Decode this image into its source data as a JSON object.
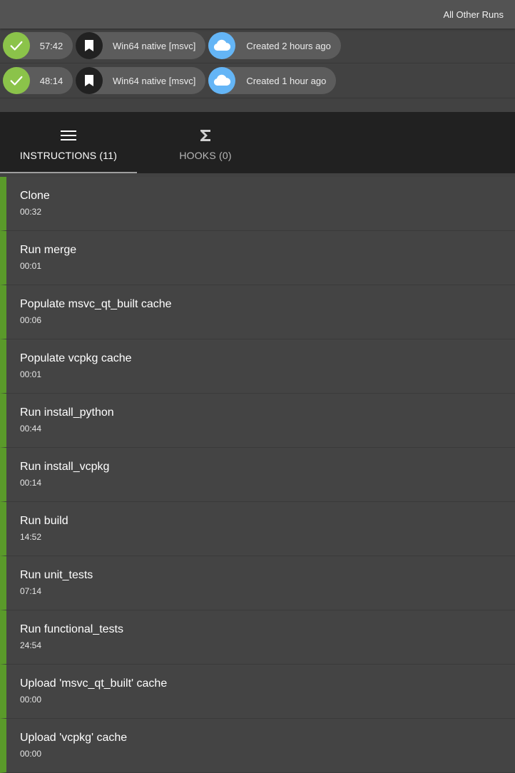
{
  "topbar": {
    "all_other_runs": "All Other Runs"
  },
  "runs": [
    {
      "duration": "57:42",
      "task": "Win64 native [msvc]",
      "created": "Created 2 hours ago"
    },
    {
      "duration": "48:14",
      "task": "Win64 native [msvc]",
      "created": "Created 1 hour ago"
    }
  ],
  "tabs": [
    {
      "label": "INSTRUCTIONS (11)",
      "icon": "menu-icon",
      "active": true
    },
    {
      "label": "HOOKS (0)",
      "icon": "sigma-icon",
      "active": false
    }
  ],
  "steps": [
    {
      "name": "Clone",
      "duration": "00:32"
    },
    {
      "name": "Run merge",
      "duration": "00:01"
    },
    {
      "name": "Populate msvc_qt_built cache",
      "duration": "00:06"
    },
    {
      "name": "Populate vcpkg cache",
      "duration": "00:01"
    },
    {
      "name": "Run install_python",
      "duration": "00:44"
    },
    {
      "name": "Run install_vcpkg",
      "duration": "00:14"
    },
    {
      "name": "Run build",
      "duration": "14:52"
    },
    {
      "name": "Run unit_tests",
      "duration": "07:14"
    },
    {
      "name": "Run functional_tests",
      "duration": "24:54"
    },
    {
      "name": "Upload 'msvc_qt_built' cache",
      "duration": "00:00"
    },
    {
      "name": "Upload 'vcpkg' cache",
      "duration": "00:00"
    }
  ],
  "colors": {
    "success": "#8bc34a",
    "step_accent": "#5a9a2a",
    "cloud": "#64b5f6",
    "bookmark_bg": "#212121"
  }
}
